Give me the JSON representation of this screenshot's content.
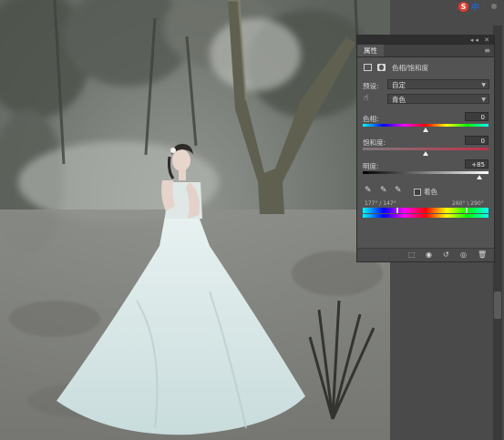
{
  "ime": {
    "logo": "S",
    "lang": "中",
    "moon": "☾"
  },
  "panel": {
    "title_tab": "属性",
    "title_ctrls": "◂◂ ✕",
    "menu_icon": "≡",
    "adjustment_name": "色相/饱和度",
    "preset_label": "预设:",
    "preset_value": "自定",
    "channel_value": "青色",
    "hue_label": "色相:",
    "hue_value": "0",
    "hue_pos": 0.5,
    "saturation_label": "饱和度:",
    "saturation_value": "0",
    "saturation_pos": 0.5,
    "lightness_label": "明度:",
    "lightness_value": "+85",
    "lightness_pos": 0.925,
    "colorize_label": "着色",
    "range_left": "177° / 147°",
    "range_right": "260° \\ 290°"
  },
  "icons": {
    "adjust_icon": "hue-saturation-icon",
    "mask_icon": "layer-mask-icon",
    "hand_icon": "target-adjust-hand-icon",
    "eyedroppers": [
      "eyedropper-icon",
      "eyedropper-plus-icon",
      "eyedropper-minus-icon"
    ],
    "bottom": [
      "clip-to-layer-icon",
      "view-previous-icon",
      "reset-icon",
      "visibility-eye-icon",
      "trash-icon"
    ]
  },
  "colors": {
    "panel_bg": "#535353",
    "accent_blue": "#1e63c8"
  }
}
